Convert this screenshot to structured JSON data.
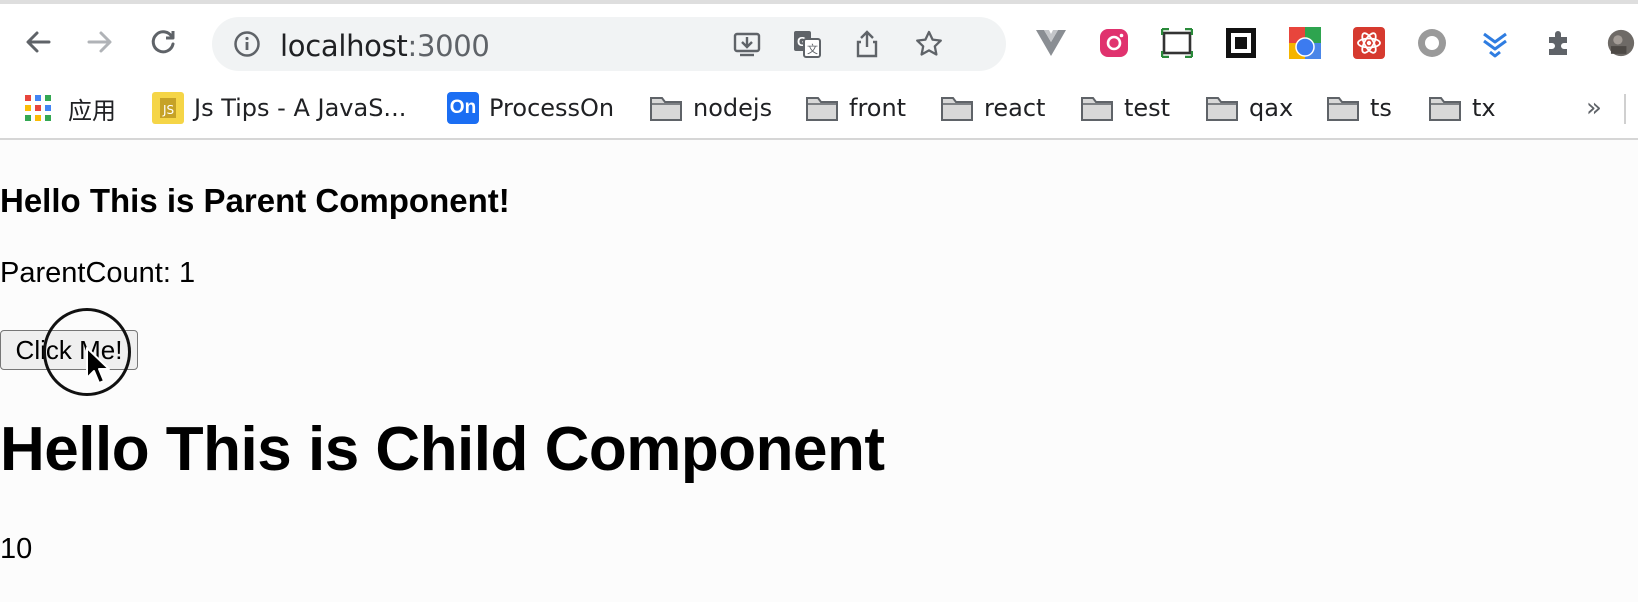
{
  "browser": {
    "url_host": "localhost",
    "url_port": ":3000",
    "toolbar_icons": [
      "back-icon",
      "forward-icon",
      "reload-icon",
      "info-icon",
      "install-icon",
      "translate-icon",
      "share-icon",
      "star-icon",
      "vue-devtools-icon",
      "instagram-icon",
      "screenshot-icon",
      "qr-icon",
      "color-picker-icon",
      "react-devtools-icon",
      "record-icon",
      "download-icon",
      "extensions-icon",
      "profile-avatar"
    ]
  },
  "bookmarks": {
    "apps_label": "应用",
    "items": [
      {
        "label": "Js Tips - A JavaS...",
        "icon": "js-tips-icon"
      },
      {
        "label": "ProcessOn",
        "icon": "processon-icon",
        "badge": "On"
      },
      {
        "label": "nodejs",
        "icon": "folder-icon"
      },
      {
        "label": "front",
        "icon": "folder-icon"
      },
      {
        "label": "react",
        "icon": "folder-icon"
      },
      {
        "label": "test",
        "icon": "folder-icon"
      },
      {
        "label": "qax",
        "icon": "folder-icon"
      },
      {
        "label": "ts",
        "icon": "folder-icon"
      },
      {
        "label": "tx",
        "icon": "folder-icon"
      }
    ],
    "more": "»"
  },
  "page": {
    "parent_heading": "Hello This is Parent Component!",
    "parent_count": "ParentCount: 1",
    "button_label": "Click Me!",
    "child_heading": "Hello This is Child Component",
    "child_value": "10"
  }
}
